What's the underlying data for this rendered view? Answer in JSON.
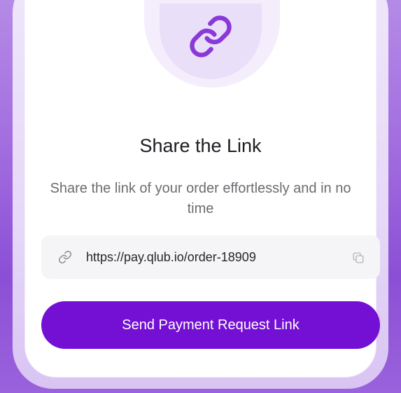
{
  "header": {
    "icon": "link-icon",
    "title": "Share the Link",
    "subtitle": "Share the link of your order effortlessly and in no time"
  },
  "link_box": {
    "icon": "link-icon",
    "url": "https://pay.qlub.io/order-18909",
    "copy_icon": "copy-icon"
  },
  "actions": {
    "primary_label": "Send Payment Request Link"
  },
  "colors": {
    "accent": "#7310d4",
    "icon_stroke": "#8a38d8",
    "background": "#a36fe0"
  }
}
